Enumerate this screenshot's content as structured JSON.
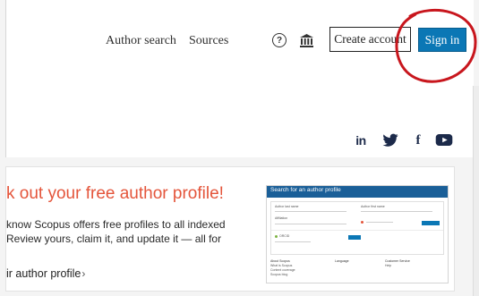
{
  "header": {
    "nav": [
      {
        "label": "Author search"
      },
      {
        "label": "Sources"
      }
    ],
    "help_icon_glyph": "?",
    "create_account_label": "Create account",
    "sign_in_label": "Sign in",
    "sign_in_color": "#0b77b5",
    "annotation_color": "#c8161d"
  },
  "social": {
    "icons": [
      "linkedin-icon",
      "twitter-icon",
      "facebook-icon",
      "youtube-icon"
    ],
    "linkedin_text": "in",
    "facebook_text": "f"
  },
  "promo": {
    "title": "k out your free author profile!",
    "desc_line1": "know Scopus offers free profiles to all indexed",
    "desc_line2": "Review yours, claim it, and update it — all for",
    "link_label": "ir author profile",
    "link_chevron": "›",
    "title_color": "#e4553b"
  },
  "preview": {
    "heading": "Search for an author profile",
    "field_author_last": "Author last name",
    "field_author_first": "Author first name",
    "field_affiliation": "Affiliation",
    "field_orcid": "ORCID",
    "footer_col1": [
      "About Scopus",
      "What is Scopus",
      "Content coverage",
      "Scopus blog"
    ],
    "footer_col2": [
      "Language"
    ],
    "footer_col3": [
      "Customer Service",
      "Help"
    ]
  }
}
